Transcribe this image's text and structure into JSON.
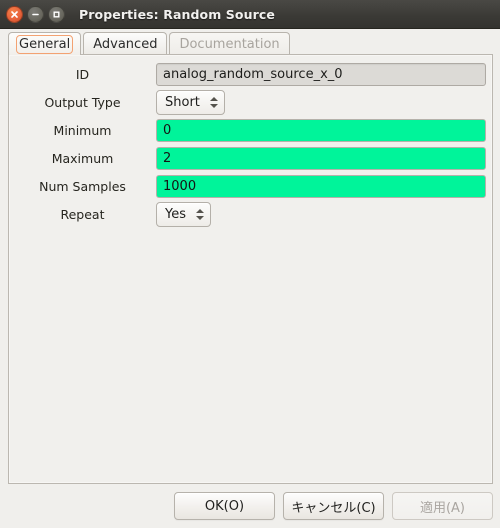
{
  "window": {
    "title": "Properties: Random Source",
    "controls": [
      {
        "name": "close",
        "glyph": "×"
      },
      {
        "name": "minimize",
        "glyph": "−"
      },
      {
        "name": "maximize",
        "glyph": "□"
      }
    ]
  },
  "tabs": [
    {
      "label": "General",
      "state": "active"
    },
    {
      "label": "Advanced",
      "state": "normal"
    },
    {
      "label": "Documentation",
      "state": "disabled"
    }
  ],
  "form": {
    "rows": [
      {
        "label": "ID",
        "type": "entry-readonly",
        "value": "analog_random_source_x_0"
      },
      {
        "label": "Output Type",
        "type": "combo",
        "value": "Short"
      },
      {
        "label": "Minimum",
        "type": "entry-valid",
        "value": "0"
      },
      {
        "label": "Maximum",
        "type": "entry-valid",
        "value": "2"
      },
      {
        "label": "Num Samples",
        "type": "entry-valid",
        "value": "1000"
      },
      {
        "label": "Repeat",
        "type": "combo",
        "value": "Yes"
      }
    ]
  },
  "buttons": [
    {
      "label": "OK(O)",
      "state": "enabled"
    },
    {
      "label": "キャンセル(C)",
      "state": "enabled"
    },
    {
      "label": "適用(A)",
      "state": "disabled"
    }
  ],
  "colors": {
    "titlebar": "#3b3a36",
    "window_background": "#f0efec",
    "valid_field_green": "#00f49a",
    "readonly_field_gray": "#dcdad6",
    "focus_outline_orange": "#f3a272",
    "close_button_orange": "#e8623a"
  }
}
